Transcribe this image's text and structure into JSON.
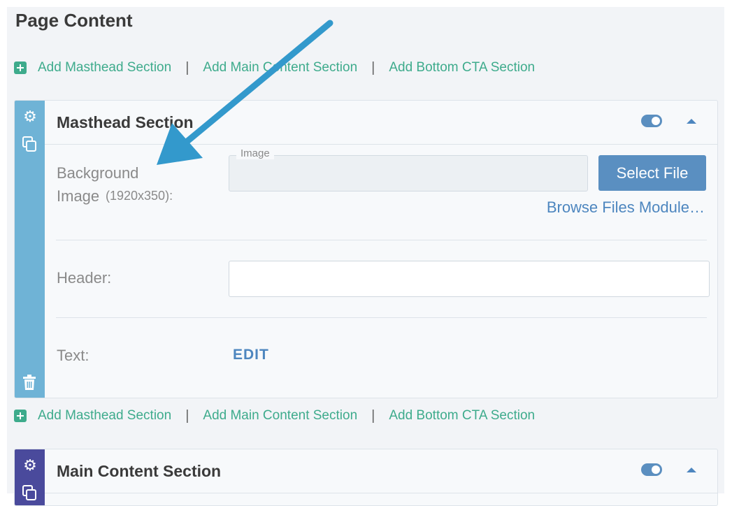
{
  "page": {
    "title": "Page Content"
  },
  "add_links": [
    {
      "masthead": "Add Masthead Section",
      "main": "Add Main Content Section",
      "cta": "Add Bottom CTA Section",
      "separator": "|"
    },
    {
      "masthead": "Add Masthead Section",
      "main": "Add Main Content Section",
      "cta": "Add Bottom CTA Section",
      "separator": "|"
    }
  ],
  "masthead_section": {
    "title": "Masthead Section",
    "strip_color": "#6fb3d6",
    "background_image_label": "Background Image",
    "background_image_size": "(1920x350):",
    "image_legend": "Image",
    "image_value": "",
    "select_file_label": "Select File",
    "browse_label": "Browse Files Module…",
    "header_label": "Header:",
    "header_value": "",
    "text_label": "Text:",
    "edit_label": "EDIT"
  },
  "main_section": {
    "title": "Main Content Section",
    "strip_color": "#4a4a9c"
  },
  "icons": {
    "add": "plus-square-icon",
    "settings": "gear-icon",
    "duplicate": "copy-icon",
    "delete": "trash-icon",
    "visibility": "toggle-icon",
    "collapse": "caret-up-icon",
    "annotation": "arrow-icon"
  },
  "colors": {
    "accent_green": "#3eab8c",
    "accent_blue": "#4d86bf",
    "button_blue": "#5a8fc1",
    "arrow_blue": "#3399cc"
  }
}
